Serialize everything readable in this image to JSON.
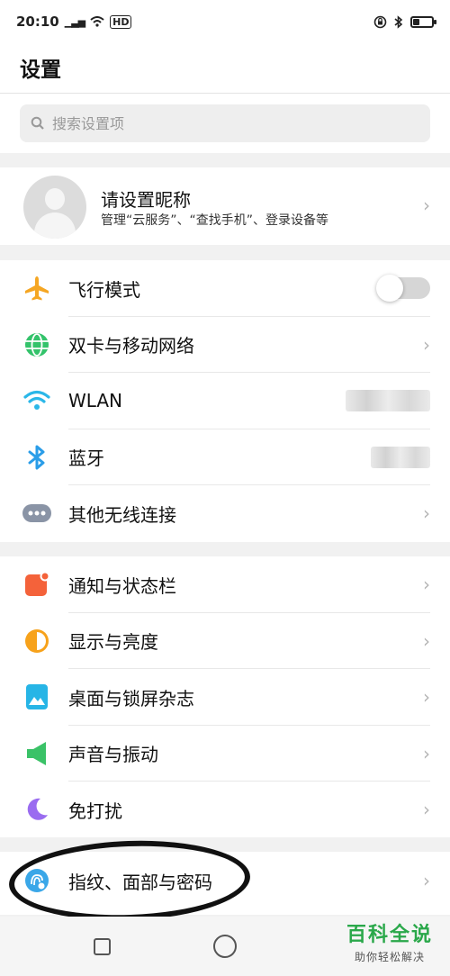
{
  "status_bar": {
    "time": "20:10",
    "signal": "▁▃▅",
    "network": "HD"
  },
  "header": {
    "title": "设置"
  },
  "search": {
    "placeholder": "搜索设置项"
  },
  "profile": {
    "name": "请设置昵称",
    "subtitle": "管理“云服务”、“查找手机”、登录设备等"
  },
  "group1": [
    {
      "label": "飞行模式",
      "icon": "airplane-icon",
      "control": "toggle",
      "value": false
    },
    {
      "label": "双卡与移动网络",
      "icon": "globe-icon",
      "control": "chevron"
    },
    {
      "label": "WLAN",
      "icon": "wifi-icon",
      "control": "value"
    },
    {
      "label": "蓝牙",
      "icon": "bluetooth-icon",
      "control": "value"
    },
    {
      "label": "其他无线连接",
      "icon": "more-dots-icon",
      "control": "chevron"
    }
  ],
  "group2": [
    {
      "label": "通知与状态栏",
      "icon": "notification-icon"
    },
    {
      "label": "显示与亮度",
      "icon": "brightness-icon"
    },
    {
      "label": "桌面与锁屏杂志",
      "icon": "wallpaper-icon"
    },
    {
      "label": "声音与振动",
      "icon": "speaker-icon"
    },
    {
      "label": "免打扰",
      "icon": "moon-icon"
    }
  ],
  "group3": [
    {
      "label": "指纹、面部与密码",
      "icon": "fingerprint-icon"
    }
  ],
  "chevron": "›",
  "watermark": {
    "title": "百科全说",
    "subtitle": "助你轻松解决"
  },
  "colors": {
    "airplane": "#f5a623",
    "globe": "#34c36b",
    "wifi": "#2ab7e8",
    "bluetooth": "#2a9de8",
    "dots": "#8a94a6",
    "notify": "#f4623a",
    "bright": "#f7a21b",
    "wallpaper": "#27b5e6",
    "sound": "#3ac267",
    "moon": "#9a6cf0",
    "finger": "#3aa7e8"
  }
}
